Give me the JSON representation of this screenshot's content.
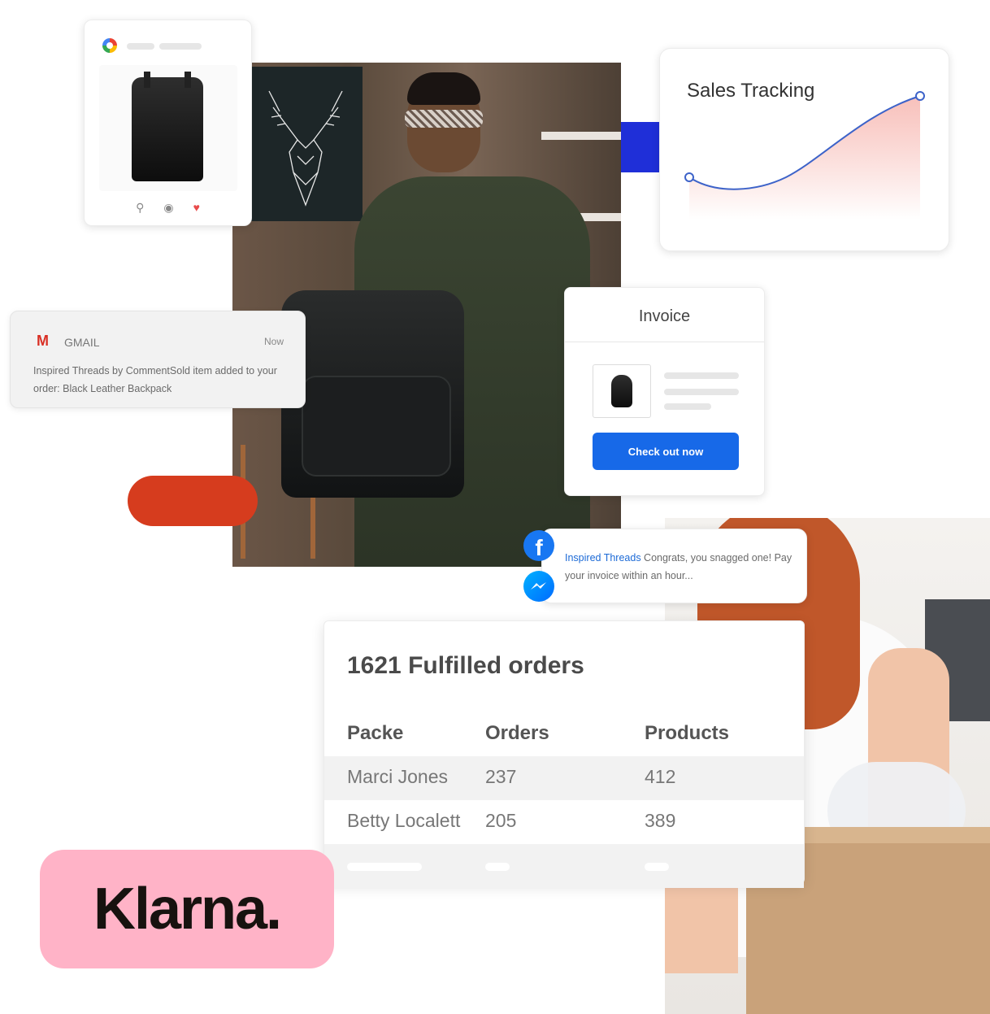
{
  "product_card": {
    "icons": [
      "search-icon",
      "camera-icon",
      "heart-icon"
    ]
  },
  "sales": {
    "title": "Sales Tracking",
    "colors": {
      "line": "#3d63c9",
      "fill": "#f7b9b3"
    }
  },
  "gmail": {
    "app_name": "GMAIL",
    "time": "Now",
    "message": "Inspired Threads by CommentSold item added to your order: Black Leather Backpack"
  },
  "invoice": {
    "title": "Invoice",
    "button_label": "Check out now"
  },
  "facebook": {
    "sender": "Inspired Threads",
    "message": " Congrats, you snagged one! Pay your invoice within an hour..."
  },
  "orders": {
    "title": "1621 Fulfilled orders",
    "columns": [
      "Packe",
      "Orders",
      "Products"
    ],
    "rows": [
      [
        "Marci Jones",
        "237",
        "412"
      ],
      [
        "Betty Localett",
        "205",
        "389"
      ]
    ]
  },
  "klarna": {
    "logo_text": "Klarna."
  },
  "colors": {
    "accent_blue": "#1769e8",
    "accent_red": "#d63c1e",
    "klarna_pink": "#ffb3c7"
  }
}
